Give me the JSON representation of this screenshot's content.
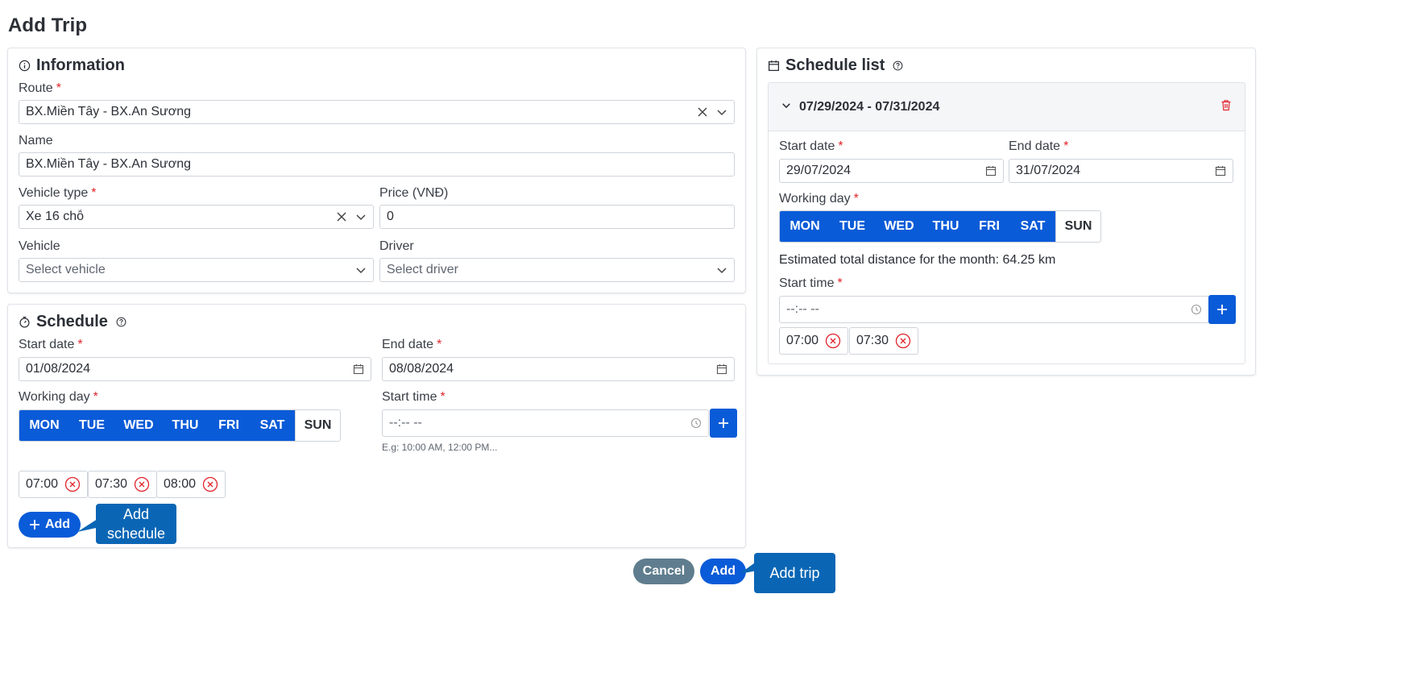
{
  "page": {
    "title": "Add Trip"
  },
  "information": {
    "title": "Information",
    "route": {
      "label": "Route",
      "value": "BX.Miền Tây - BX.An Sương"
    },
    "name": {
      "label": "Name",
      "value": "BX.Miền Tây - BX.An Sương"
    },
    "vehicle_type": {
      "label": "Vehicle type",
      "value": "Xe 16 chỗ"
    },
    "price": {
      "label": "Price (VNĐ)",
      "value": "0"
    },
    "vehicle": {
      "label": "Vehicle",
      "placeholder": "Select vehicle"
    },
    "driver": {
      "label": "Driver",
      "placeholder": "Select driver"
    }
  },
  "schedule": {
    "title": "Schedule",
    "start_date": {
      "label": "Start date",
      "value": "01/08/2024"
    },
    "end_date": {
      "label": "End date",
      "value": "08/08/2024"
    },
    "working_day": {
      "label": "Working day"
    },
    "start_time": {
      "label": "Start time",
      "placeholder": "--:-- --",
      "hint": "E.g: 10:00 AM, 12:00 PM..."
    },
    "times": [
      "07:00",
      "07:30",
      "08:00"
    ],
    "add_label": "Add"
  },
  "days": [
    {
      "label": "MON",
      "selected": true
    },
    {
      "label": "TUE",
      "selected": true
    },
    {
      "label": "WED",
      "selected": true
    },
    {
      "label": "THU",
      "selected": true
    },
    {
      "label": "FRI",
      "selected": true
    },
    {
      "label": "SAT",
      "selected": true
    },
    {
      "label": "SUN",
      "selected": false
    }
  ],
  "schedule_list": {
    "title": "Schedule list",
    "item": {
      "range": "07/29/2024 - 07/31/2024",
      "start_date": {
        "label": "Start date",
        "value": "29/07/2024"
      },
      "end_date": {
        "label": "End date",
        "value": "31/07/2024"
      },
      "working_day": {
        "label": "Working day"
      },
      "estimate": "Estimated total distance for the month: 64.25 km",
      "start_time": {
        "label": "Start time",
        "placeholder": "--:-- --"
      },
      "times": [
        "07:00",
        "07:30"
      ]
    }
  },
  "footer": {
    "cancel_label": "Cancel",
    "add_label": "Add"
  },
  "callouts": {
    "add_schedule": "Add\nschedule",
    "add_trip": "Add trip"
  },
  "colors": {
    "primary": "#0a5bd8",
    "callout": "#0a66b5",
    "danger": "#e0242c",
    "cancel": "#5f7d8e"
  }
}
